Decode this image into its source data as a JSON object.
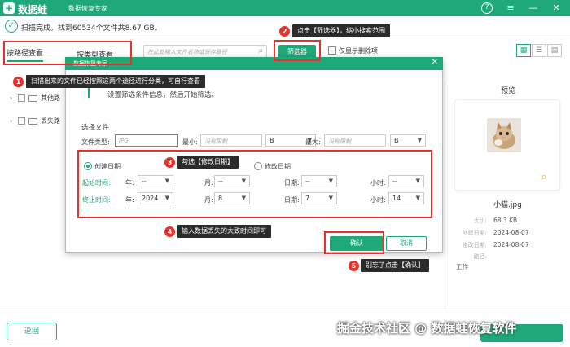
{
  "app": {
    "name": "数据蛙",
    "subtitle": "数据恢复专家"
  },
  "scan_status": "扫描完成。找到60534个文件共8.67 GB。",
  "toolbar": {
    "tab_by_path": "按路径查看",
    "tab_by_type": "按类型查看",
    "search_placeholder": "在此处输入文件名称或保存路径",
    "filter_button": "筛选器",
    "deleted_only_label": "仅显示删除项"
  },
  "tree": {
    "items": [
      {
        "label": "其他路"
      },
      {
        "label": "丢失路"
      }
    ]
  },
  "dialog": {
    "title": "数据恢复专家",
    "intro": "设置筛选条件信息，然后开始筛选。",
    "section_title": "选择文件",
    "file_type_label": "文件类型:",
    "file_type_placeholder": "JPG",
    "min_size_label": "最小:",
    "min_size_placeholder": "没有限制",
    "min_unit": "B",
    "max_size_label": "最大:",
    "max_size_placeholder": "没有限制",
    "max_unit": "B",
    "created_date_label": "创建日期",
    "modified_date_label": "修改日期",
    "start_time_label": "起始时间:",
    "end_time_label": "终止时间:",
    "year_label": "年:",
    "month_label": "月:",
    "day_label": "日期:",
    "hour_label": "小时:",
    "start": {
      "year": "--",
      "month": "--",
      "day": "--",
      "hour": "--"
    },
    "end": {
      "year": "2024",
      "month": "8",
      "day": "7",
      "hour": "14"
    },
    "confirm_button": "确认",
    "cancel_button": "取消"
  },
  "preview": {
    "title": "预览",
    "file_name": "小猫.jpg",
    "meta": [
      {
        "label": "大小:",
        "value": "68.3 KB"
      },
      {
        "label": "创建日期:",
        "value": "2024-08-07"
      },
      {
        "label": "修改日期:",
        "value": "2024-08-07"
      },
      {
        "label": "路径:",
        "value": ""
      },
      {
        "label": "",
        "value": "工作"
      }
    ]
  },
  "bottom": {
    "back_button": "返回"
  },
  "watermark": "掘金技术社区 @ 数据蛙恢复软件",
  "callouts": [
    {
      "num": "1",
      "text": "扫描出来的文件已经按照这两个途径进行分类，可自行查看"
    },
    {
      "num": "2",
      "text": "点击【筛选器】，缩小搜索范围"
    },
    {
      "num": "3",
      "text": "勾选【修改日期】"
    },
    {
      "num": "4",
      "text": "输入数据丢失的大致时间即可"
    },
    {
      "num": "5",
      "text": "别忘了点击【确认】"
    }
  ],
  "colors": {
    "accent": "#1fa97a",
    "annotation_red": "#e8312a",
    "callout_bg": "#2b2b2b"
  },
  "icons": [
    "help-icon",
    "menu-icon",
    "minimize-icon",
    "close-icon",
    "search-icon",
    "zoom-icon",
    "grid-view-icon",
    "list-view-icon",
    "detail-view-icon"
  ]
}
